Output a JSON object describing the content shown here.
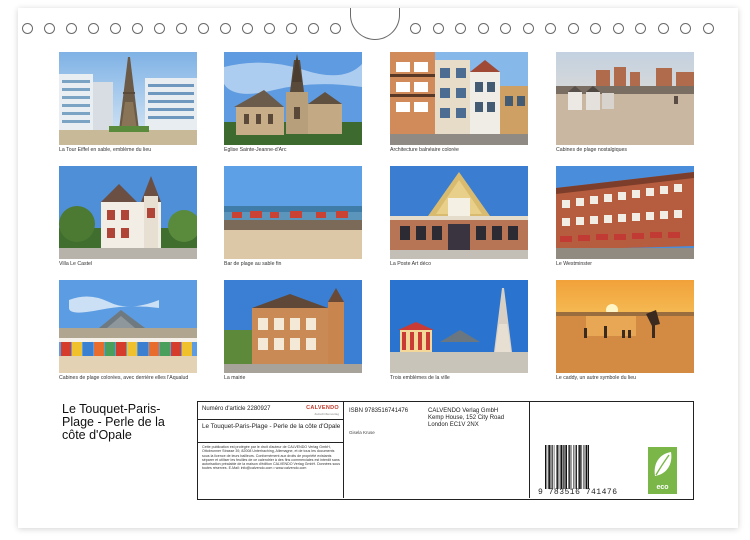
{
  "photos": [
    {
      "caption": "La Tour Eiffel en sable, emblème du lieu"
    },
    {
      "caption": "Eglise Sainte-Jeanne-d'Arc"
    },
    {
      "caption": "Architecture balnéaire colorée"
    },
    {
      "caption": "Cabines de plage nostalgiques"
    },
    {
      "caption": "Villa Le Castel"
    },
    {
      "caption": "Bar de plage au sable fin"
    },
    {
      "caption": "La Poste Art déco"
    },
    {
      "caption": "Le Westminster"
    },
    {
      "caption": "Cabines de plage colorées, avec derrière elles l'Aqualud"
    },
    {
      "caption": "La mairie"
    },
    {
      "caption": "Trois emblèmes de la ville"
    },
    {
      "caption": "Le caddy, un autre symbole du lieu"
    }
  ],
  "title": "Le Touquet-Paris-Plage - Perle de la côte d'Opale",
  "info": {
    "article_number": "Numéro d'article 2280927",
    "brand": "CALVENDO",
    "brand_sub": "Zeitschriftenverlag",
    "subtitle": "Le Touquet-Paris-Plage - Perle de la côte d'Opale",
    "legal": "Cette publication est protégée par le droit d'auteur de CALVENDO Verlag GmbH, Ottobrunner Strasse 39, 82008 Unterhaching, Allemagne, et de tous les documents sous la licence de leurs bailleurs. Conformément aux droits de propriété existants séparer et utiliser les feuilles de ce calendrier à des fins commerciales est interdit sans autorisation préalable de la maison d'édition CALVENDO Verlag GmbH. Données sous toutes réserves. E-Mail: info@calvendo.com • www.calvendo.com",
    "isbn": "ISBN 9783516741476",
    "author": "Gisela Kruse",
    "publisher_name": "CALVENDO Verlag GmbH",
    "publisher_street": "Kemp House, 152 City Road",
    "publisher_city": "London EC1V 2NX",
    "barcode_number": "9 783516 741476",
    "eco_label": "eco"
  },
  "colors": {
    "eco_green": "#7ab648",
    "brand_red": "#c0392b"
  }
}
